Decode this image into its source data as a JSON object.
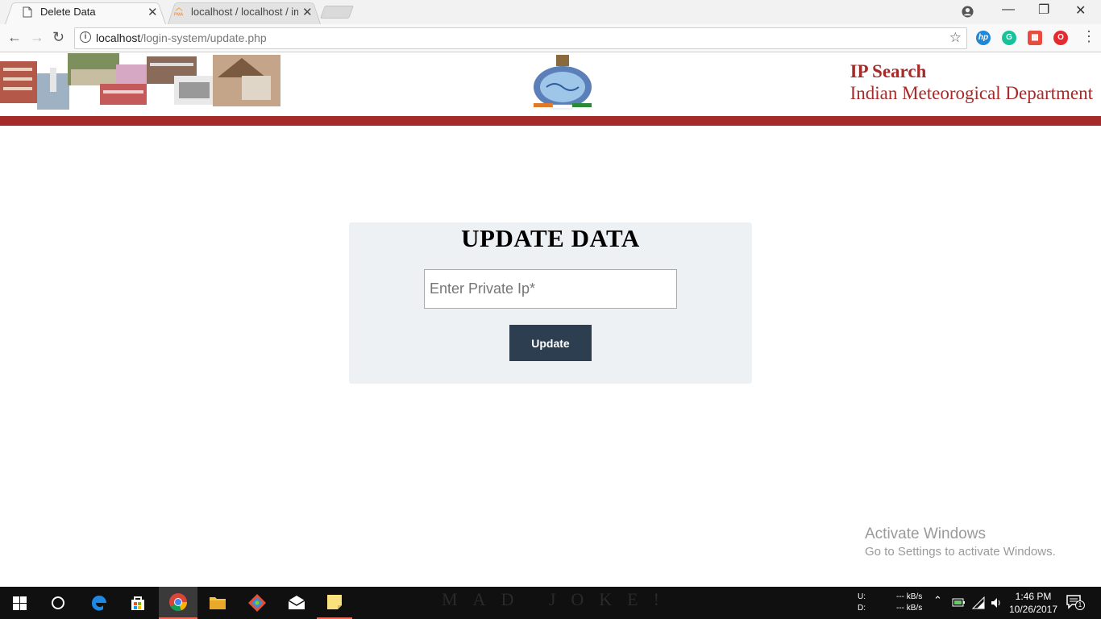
{
  "browser": {
    "tabs": [
      {
        "title": "Delete Data",
        "active": true
      },
      {
        "title": "localhost / localhost / im",
        "active": false
      }
    ],
    "address": {
      "host": "localhost",
      "path": "/login-system/update.php"
    }
  },
  "header": {
    "title_line1": "IP Search",
    "title_line2": "Indian Meteorogical Department",
    "accent_color": "#a52a2a"
  },
  "form": {
    "heading": "UPDATE DATA",
    "ip_placeholder": "Enter Private Ip*",
    "ip_value": "",
    "submit_label": "Update",
    "button_color": "#2d3e50"
  },
  "watermark": {
    "line1": "Activate Windows",
    "line2": "Go to Settings to activate Windows."
  },
  "taskbar": {
    "wallpaper_text": "MAD JOKE!",
    "net_up_label": "U:",
    "net_down_label": "D:",
    "net_up_rate": "--- kB/s",
    "net_down_rate": "--- kB/s",
    "time": "1:46 PM",
    "date": "10/26/2017",
    "notification_count": "1"
  }
}
